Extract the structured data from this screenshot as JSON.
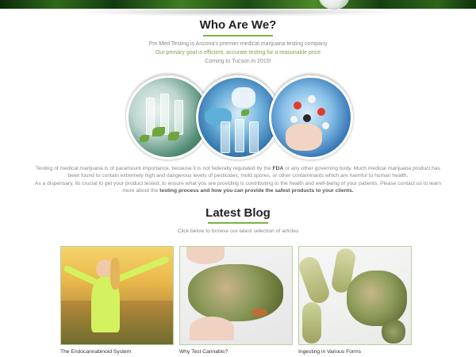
{
  "about": {
    "title": "Who Are We?",
    "line1": "Pre Med Testing is Arizona's premier medical marijuana testing company",
    "line2": "Our primary goal is efficient, accurate testing for a reasonable price",
    "line3": "Coming to Tucson in 2015!",
    "para1_a": "Testing of medical marijuana is of paramount importance, because it is not federally regulated by the ",
    "para1_b": "FDA",
    "para1_c": " or any other governing body. Much medical marijuana product has been found to contain extremely high and dangerous levels of pesticides, mold spores, or other contaminants which are harmful to human health.",
    "para2_a": "As a dispensary, its crucial to get your product tested, to ensure what you are providing is contributing to the health and well-being of your patients. Please contact us to learn more about the ",
    "para2_b": "testing process and how you can provide the safest products to your clients."
  },
  "blog": {
    "title": "Latest Blog",
    "subtitle": "Click below to browse our latest selection of articles",
    "posts": [
      {
        "title": "The Endocannabinoid System"
      },
      {
        "title": "Why Test Cannabis?"
      },
      {
        "title": "Ingesting in Various Forms"
      }
    ]
  },
  "colors": {
    "accent": "#7ab342",
    "heading": "#222222"
  }
}
